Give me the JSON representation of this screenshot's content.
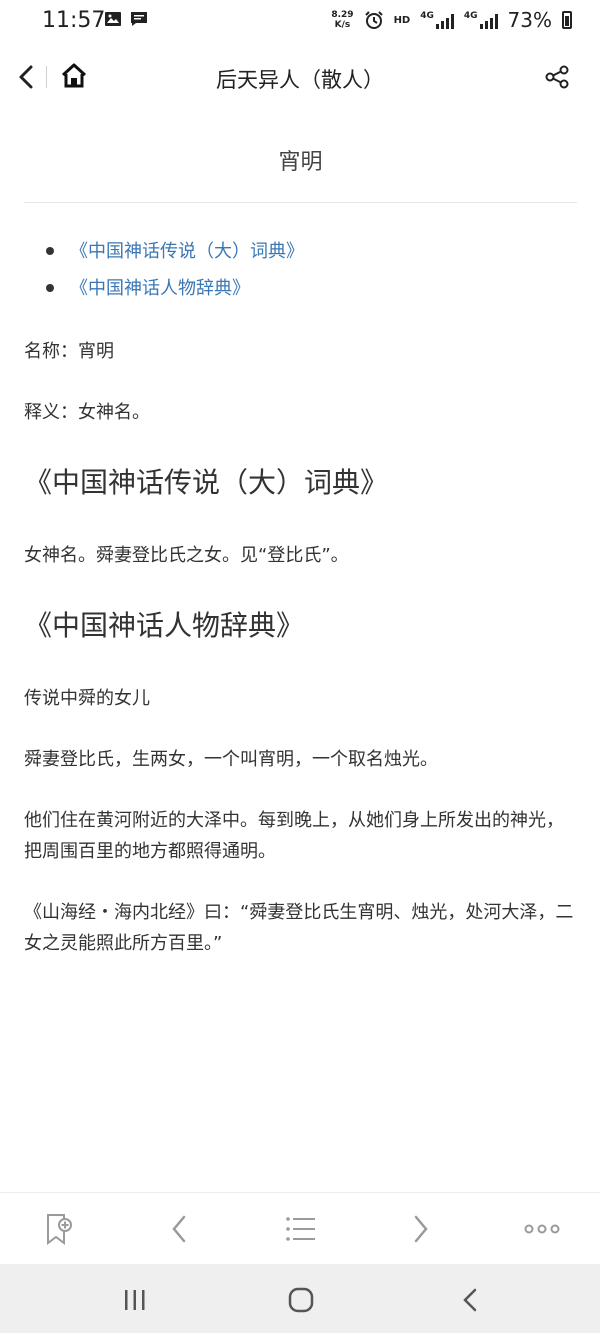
{
  "status": {
    "time": "11:57",
    "net_speed_value": "8.29",
    "net_speed_unit": "K/s",
    "hd_label": "HD",
    "network_1": "4G",
    "network_2": "4G",
    "battery": "73%"
  },
  "nav": {
    "title": "后天异人（散人）"
  },
  "article": {
    "title": "宵明",
    "toc": [
      "《中国神话传说（大）词典》",
      "《中国神话人物辞典》"
    ],
    "name_line": "名称：宵明",
    "definition_line": "释义：女神名。",
    "sections": [
      {
        "heading": "《中国神话传说（大）词典》",
        "paragraphs": [
          "女神名。舜妻登比氏之女。见“登比氏”。"
        ]
      },
      {
        "heading": "《中国神话人物辞典》",
        "paragraphs": [
          "传说中舜的女儿",
          "舜妻登比氏，生两女，一个叫宵明，一个取名烛光。",
          "他们住在黄河附近的大泽中。每到晚上，从她们身上所发出的神光，把周围百里的地方都照得通明。",
          "《山海经・海内北经》曰：“舜妻登比氏生宵明、烛光，处河大泽，二女之灵能照此所方百里。”"
        ]
      }
    ]
  },
  "icons": {
    "back": "chevron-left-icon",
    "home": "home-icon",
    "share": "share-icon",
    "bookmark": "bookmark-add-icon",
    "prev": "chevron-left-icon",
    "toc": "list-icon",
    "next": "chevron-right-icon",
    "more": "more-dots-icon"
  },
  "colors": {
    "link": "#3a77b6",
    "text": "#333333",
    "toolbar_icon": "#9a9a9a"
  }
}
